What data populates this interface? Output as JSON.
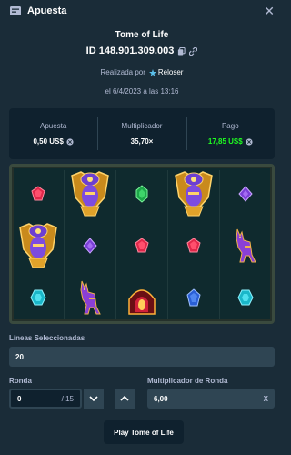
{
  "modal": {
    "title": "Apuesta",
    "close_icon": "close-icon"
  },
  "bet": {
    "game": "Tome of Life",
    "id": "ID 148.901.309.003",
    "placed_by_label": "Realizada por",
    "user": "Reloser",
    "date": "el 6/4/2023 a las 13:16"
  },
  "stats": {
    "bet_label": "Apuesta",
    "bet_value": "0,50 US$",
    "multiplier_label": "Multiplicador",
    "multiplier_value": "35,70×",
    "payout_label": "Pago",
    "payout_value": "17,85 US$"
  },
  "board": {
    "grid": [
      [
        "red-gem",
        "pharaoh-mask",
        "green-gem",
        "pharaoh-mask",
        "purple-gem"
      ],
      [
        "pharaoh-mask",
        "purple-gem",
        "red-gem",
        "red-gem",
        "jackal-statue"
      ],
      [
        "cyan-gem",
        "jackal-statue",
        "book-of-life",
        "blue-gem",
        "cyan-gem"
      ]
    ]
  },
  "form": {
    "lines_label": "Líneas Seleccionadas",
    "lines_value": "20",
    "round_label": "Ronda",
    "round_value": "0",
    "round_total": "/ 15",
    "round_multiplier_label": "Multiplicador de Ronda",
    "round_multiplier_value": "6,00",
    "round_multiplier_suffix": "X"
  },
  "play_button": "Play Tome of Life",
  "colors": {
    "background": "#1a2c38",
    "panel": "#0f212e",
    "win": "#1fff20",
    "muted": "#b1bad3"
  }
}
